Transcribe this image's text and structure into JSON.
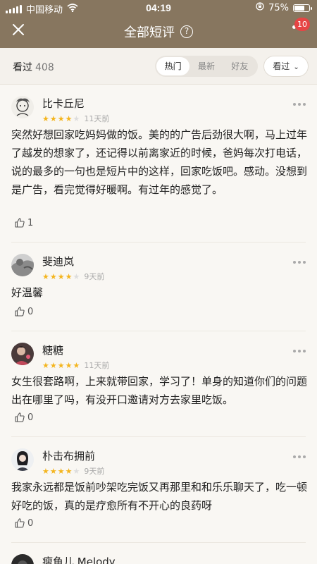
{
  "status": {
    "carrier": "中国移动",
    "time": "04:19",
    "battery": "75%",
    "battery_level": 0.75
  },
  "nav": {
    "title": "全部短评",
    "help": "?",
    "badge": "10"
  },
  "subheader": {
    "label": "看过",
    "count": "408",
    "tabs": [
      "热门",
      "最新",
      "好友"
    ],
    "active_tab": "热门",
    "sort_label": "看过"
  },
  "reviews": [
    {
      "name": "比卡丘尼",
      "rating": 4,
      "time": "11天前",
      "text": "突然好想回家吃妈妈做的饭。美的的广告后劲很大啊，马上过年了越发的想家了，还记得以前离家近的时候，爸妈每次打电话，说的最多的一句也是短片中的这样，回家吃饭吧。感动。没想到是广告，看完觉得好暖啊。有过年的感觉了。",
      "likes": "1"
    },
    {
      "name": "斐迪岚",
      "rating": 4,
      "time": "9天前",
      "text": "好温馨",
      "likes": "0"
    },
    {
      "name": "糖糖",
      "rating": 5,
      "time": "11天前",
      "text": "女生很套路啊，上来就带回家，学习了！单身的知道你们的问题出在哪里了吗，有没开口邀请对方去家里吃饭。",
      "likes": "0"
    },
    {
      "name": "朴击布拥前",
      "rating": 4,
      "time": "9天前",
      "text": "我家永远都是饭前吵架吃完饭又再那里和和乐乐聊天了，吃一顿好吃的饭，真的是疗愈所有不开心的良药呀",
      "likes": "0"
    },
    {
      "name": "瘦鱼儿 Melody"
    }
  ]
}
